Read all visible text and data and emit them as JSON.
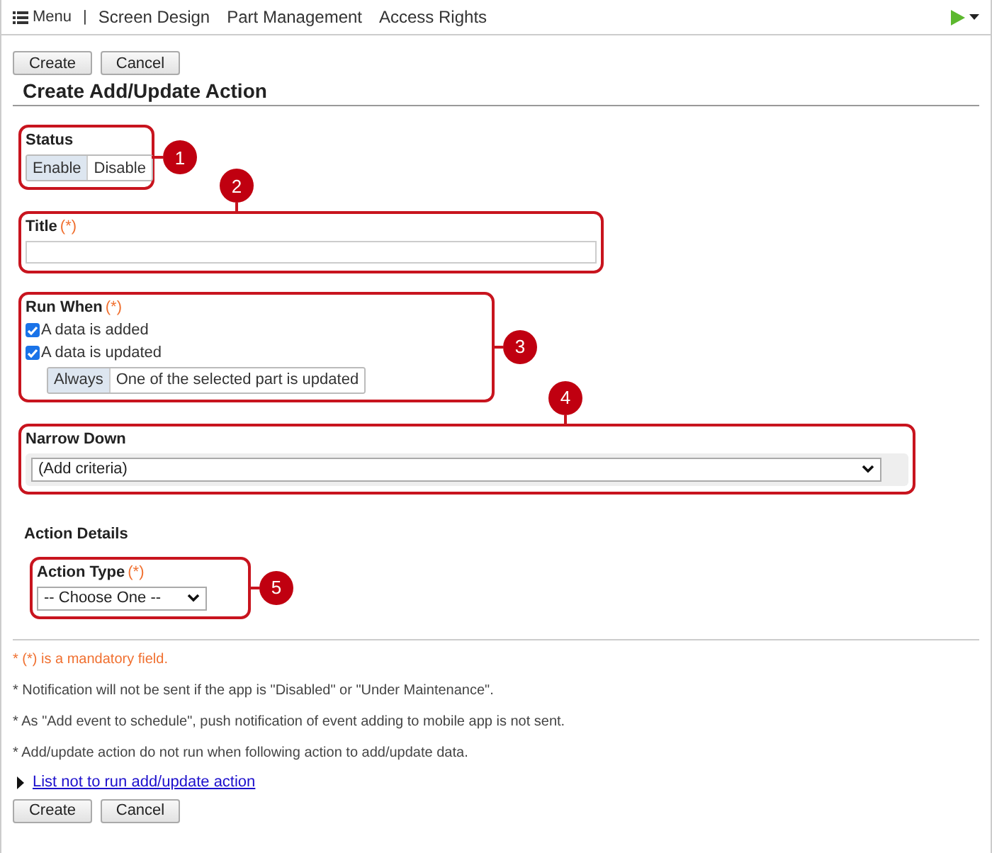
{
  "nav": {
    "menu": "Menu",
    "separator": "|",
    "items": [
      "Screen Design",
      "Part Management",
      "Access Rights"
    ]
  },
  "top_buttons": [
    "Create",
    "Cancel"
  ],
  "heading": "Create Add/Update Action",
  "status": {
    "callout": "1",
    "label": "Status",
    "options": [
      {
        "label": "Enable",
        "selected": true
      },
      {
        "label": "Disable",
        "selected": false
      }
    ]
  },
  "title_field": {
    "callout": "2",
    "label": "Title",
    "required": "(*)"
  },
  "run_when": {
    "callout": "3",
    "label": "Run When",
    "required": "(*)",
    "checkboxes": [
      {
        "label": "A data is added",
        "checked": true
      },
      {
        "label": "A data is updated",
        "checked": true
      }
    ],
    "update_options": [
      {
        "label": "Always",
        "selected": true
      },
      {
        "label": "One of the selected part is updated",
        "selected": false
      }
    ]
  },
  "narrow_down": {
    "callout": "4",
    "label": "Narrow Down",
    "value": "(Add criteria)"
  },
  "action_details": "Action Details",
  "action_type": {
    "callout": "5",
    "label": "Action Type",
    "required": "(*)",
    "value": "-- Choose One --"
  },
  "notes": [
    {
      "kind": "mandatory",
      "text": "* (*) is a mandatory field."
    },
    {
      "kind": "info",
      "text": "* Notification will not be sent if the app is \"Disabled\" or \"Under Maintenance\"."
    },
    {
      "kind": "info",
      "text": "* As \"Add event to schedule\", push notification of event adding to mobile app is not sent."
    },
    {
      "kind": "info",
      "text": "* Add/update action do not run when following action to add/update data."
    }
  ],
  "link": "List not to run add/update action",
  "bottom_buttons": [
    "Create",
    "Cancel"
  ]
}
